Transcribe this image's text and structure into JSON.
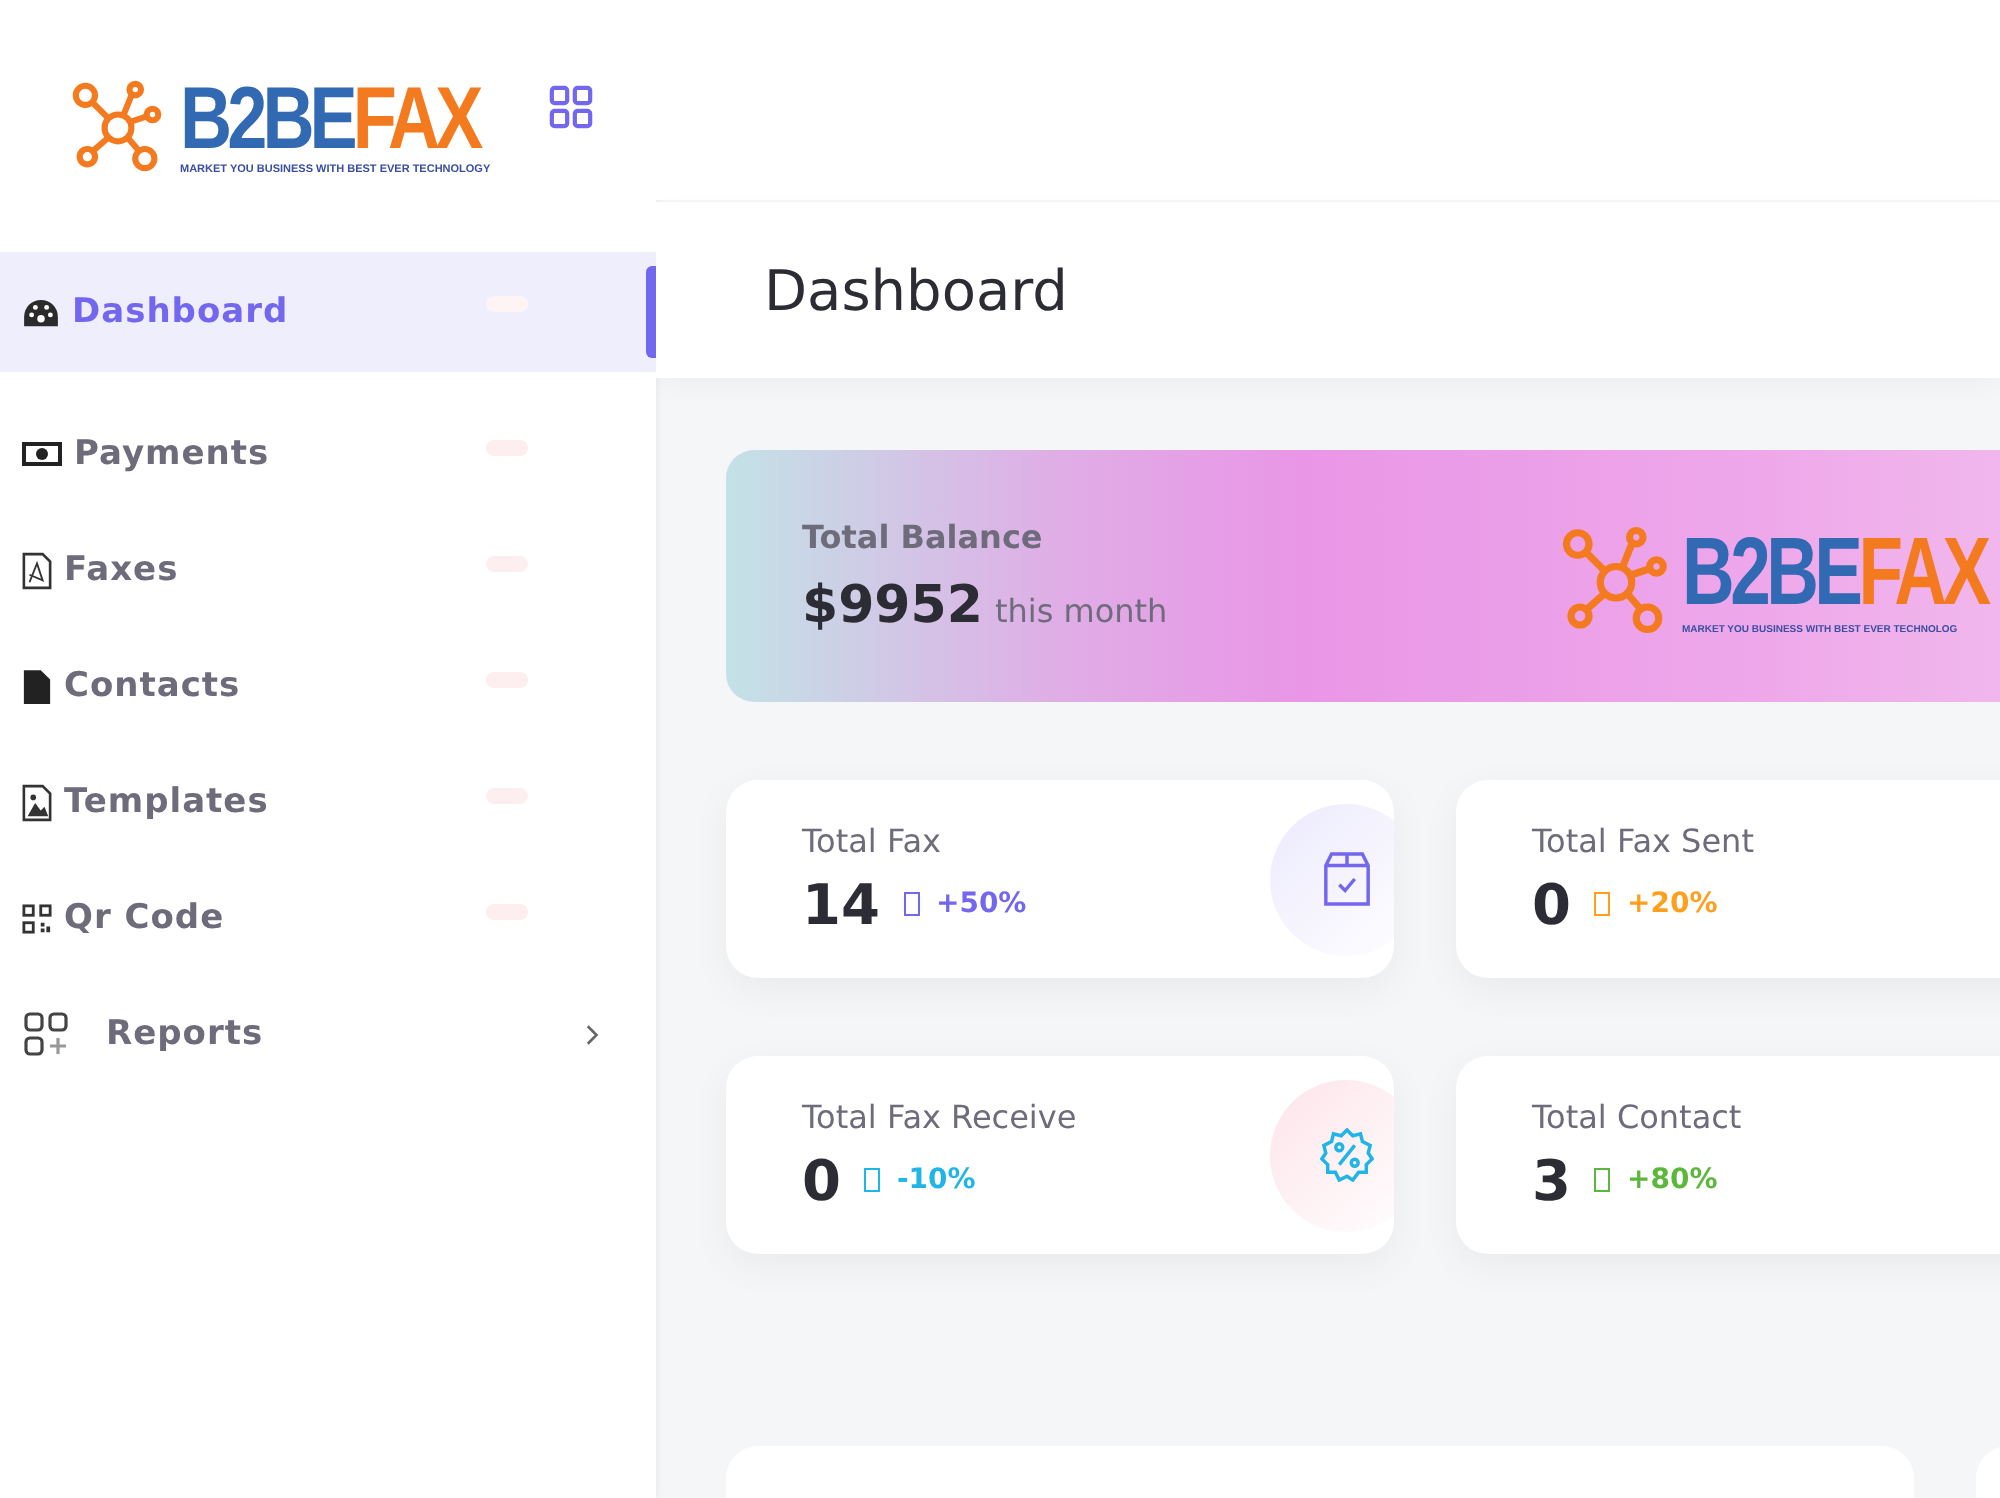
{
  "brand": {
    "name_first": "B2BE",
    "name_second": "FAX",
    "tagline": "MARKET YOU BUSINESS WITH BEST EVER TECHNOLOGY"
  },
  "sidebar": {
    "items": [
      {
        "label": "Dashboard",
        "kind": "link",
        "selected": true
      },
      {
        "label": "Payments",
        "kind": "link",
        "selected": false
      },
      {
        "label": "Faxes",
        "kind": "link",
        "selected": false
      },
      {
        "label": "Contacts",
        "kind": "link",
        "selected": false
      },
      {
        "label": "Templates",
        "kind": "link",
        "selected": false
      },
      {
        "label": "Qr Code",
        "kind": "link",
        "selected": false
      },
      {
        "label": "Reports",
        "kind": "group",
        "selected": false
      }
    ]
  },
  "page_title": "Dashboard",
  "balance": {
    "label": "Total Balance",
    "amount": "$9952",
    "period": "this month",
    "logo": {
      "name_first": "B2BE",
      "name_second": "FAX",
      "tagline": "MARKET YOU BUSINESS WITH BEST EVER TECHNOLOG"
    }
  },
  "stats": [
    {
      "label": "Total Fax",
      "value": "14",
      "change": "+50%",
      "color": "#7367f0"
    },
    {
      "label": "Total Fax Sent",
      "value": "0",
      "change": "+20%",
      "color": "#ff9f1c"
    },
    {
      "label": "Total Fax Receive",
      "value": "0",
      "change": "-10%",
      "color": "#1fb5e6"
    },
    {
      "label": "Total Contact",
      "value": "3",
      "change": "+80%",
      "color": "#5cb83c"
    }
  ]
}
